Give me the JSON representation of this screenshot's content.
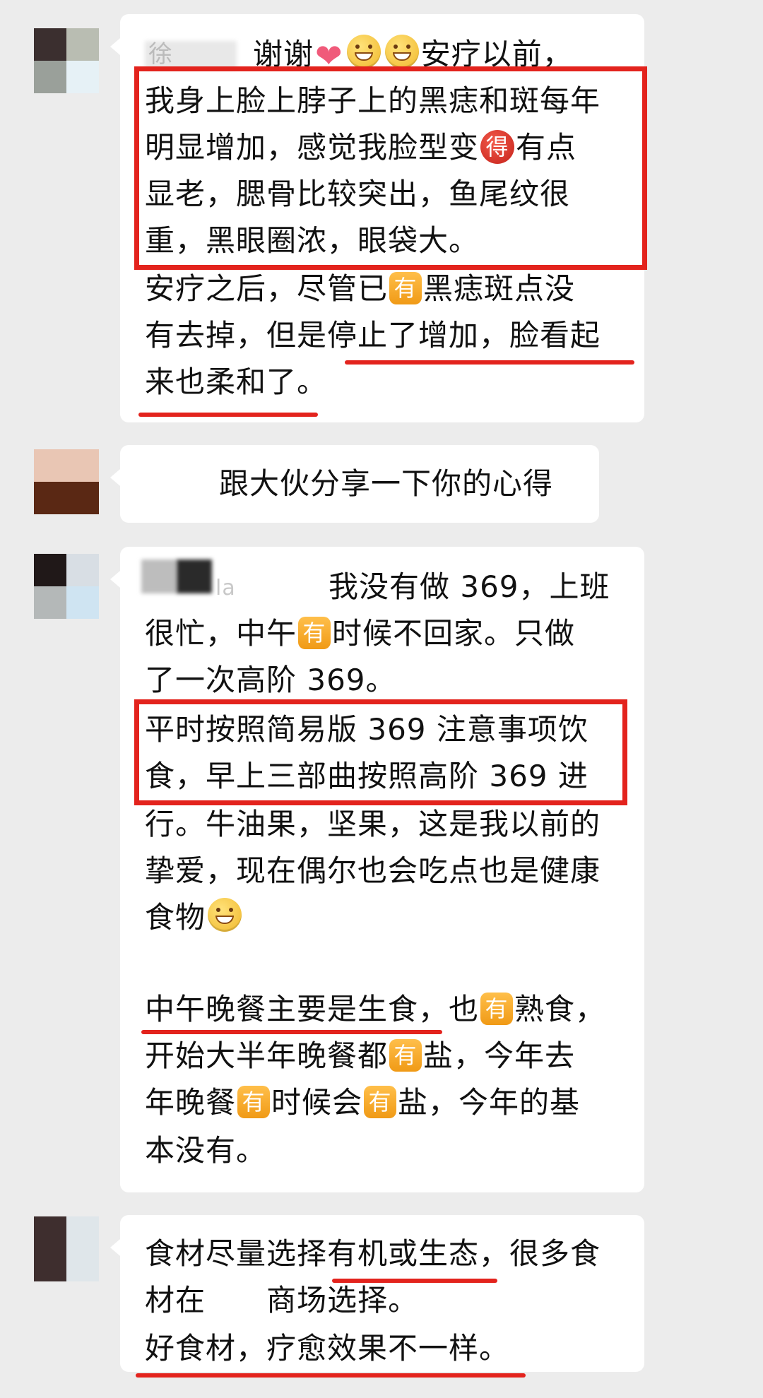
{
  "messages": [
    {
      "sender_name": "徐 ",
      "lines": [
        {
          "parts": [
            {
              "t": "text",
              "v": "谢谢"
            },
            {
              "t": "heart",
              "v": "❤"
            },
            {
              "t": "emoji",
              "v": ""
            },
            {
              "t": "emoji",
              "v": ""
            },
            {
              "t": "text",
              "v": "安疗以前，"
            }
          ]
        },
        {
          "parts": [
            {
              "t": "text",
              "v": "我身上脸上脖子上的黑痣和斑每年"
            }
          ]
        },
        {
          "parts": [
            {
              "t": "text",
              "v": "明显增加，感觉我脸型变"
            },
            {
              "t": "red",
              "v": "得"
            },
            {
              "t": "text",
              "v": "有点"
            }
          ]
        },
        {
          "parts": [
            {
              "t": "text",
              "v": "显老，腮骨比较突出，鱼尾纹很"
            }
          ]
        },
        {
          "parts": [
            {
              "t": "text",
              "v": "重，黑眼圈浓，眼袋大。"
            }
          ]
        },
        {
          "parts": [
            {
              "t": "text",
              "v": "安疗之后，尽管已"
            },
            {
              "t": "badge",
              "v": "有"
            },
            {
              "t": "text",
              "v": "黑痣斑点没"
            }
          ]
        },
        {
          "parts": [
            {
              "t": "text",
              "v": "有去掉，但是停止了增加，脸看起"
            }
          ]
        },
        {
          "parts": [
            {
              "t": "text",
              "v": "来也柔和了。"
            }
          ]
        }
      ]
    },
    {
      "lines": [
        {
          "parts": [
            {
              "t": "text",
              "v": "跟大伙分享一下你的心得"
            }
          ]
        }
      ]
    },
    {
      "sender_name": "la",
      "lines": [
        {
          "parts": [
            {
              "t": "text",
              "v": "我没有做 369，上班"
            }
          ]
        },
        {
          "parts": [
            {
              "t": "text",
              "v": "很忙，中午"
            },
            {
              "t": "badge",
              "v": "有"
            },
            {
              "t": "text",
              "v": "时候不回家。只做"
            }
          ]
        },
        {
          "parts": [
            {
              "t": "text",
              "v": "了一次高阶 369。"
            }
          ]
        },
        {
          "parts": [
            {
              "t": "text",
              "v": "平时按照简易版 369 注意事项饮"
            }
          ]
        },
        {
          "parts": [
            {
              "t": "text",
              "v": "食，早上三部曲按照高阶 369 进"
            }
          ]
        },
        {
          "parts": [
            {
              "t": "text",
              "v": "行。牛油果，坚果，这是我以前的"
            }
          ]
        },
        {
          "parts": [
            {
              "t": "text",
              "v": "挚爱，现在偶尔也会吃点也是健康"
            }
          ]
        },
        {
          "parts": [
            {
              "t": "text",
              "v": "食物"
            },
            {
              "t": "emoji",
              "v": ""
            }
          ]
        },
        {
          "parts": [
            {
              "t": "text",
              "v": "中午晚餐主要是生食，也"
            },
            {
              "t": "badge",
              "v": "有"
            },
            {
              "t": "text",
              "v": "熟食，"
            }
          ]
        },
        {
          "parts": [
            {
              "t": "text",
              "v": "开始大半年晚餐都"
            },
            {
              "t": "badge",
              "v": "有"
            },
            {
              "t": "text",
              "v": "盐，今年去"
            }
          ]
        },
        {
          "parts": [
            {
              "t": "text",
              "v": "年晚餐"
            },
            {
              "t": "badge",
              "v": "有"
            },
            {
              "t": "text",
              "v": "时候会"
            },
            {
              "t": "badge",
              "v": "有"
            },
            {
              "t": "text",
              "v": "盐，今年的基"
            }
          ]
        },
        {
          "parts": [
            {
              "t": "text",
              "v": "本没有。"
            }
          ]
        }
      ]
    },
    {
      "lines": [
        {
          "parts": [
            {
              "t": "text",
              "v": "食材尽量选择有机或生态，很多食"
            }
          ]
        },
        {
          "parts": [
            {
              "t": "text",
              "v": "材在"
            },
            {
              "t": "gap",
              "v": "      "
            },
            {
              "t": "text",
              "v": "商场选择。"
            }
          ]
        },
        {
          "parts": [
            {
              "t": "text",
              "v": "好食材，疗愈效果不一样。"
            }
          ]
        }
      ]
    }
  ],
  "colors": {
    "highlight": "#e3231d",
    "bubble": "#ffffff",
    "background": "#ececec",
    "badge": "#f5a623"
  }
}
